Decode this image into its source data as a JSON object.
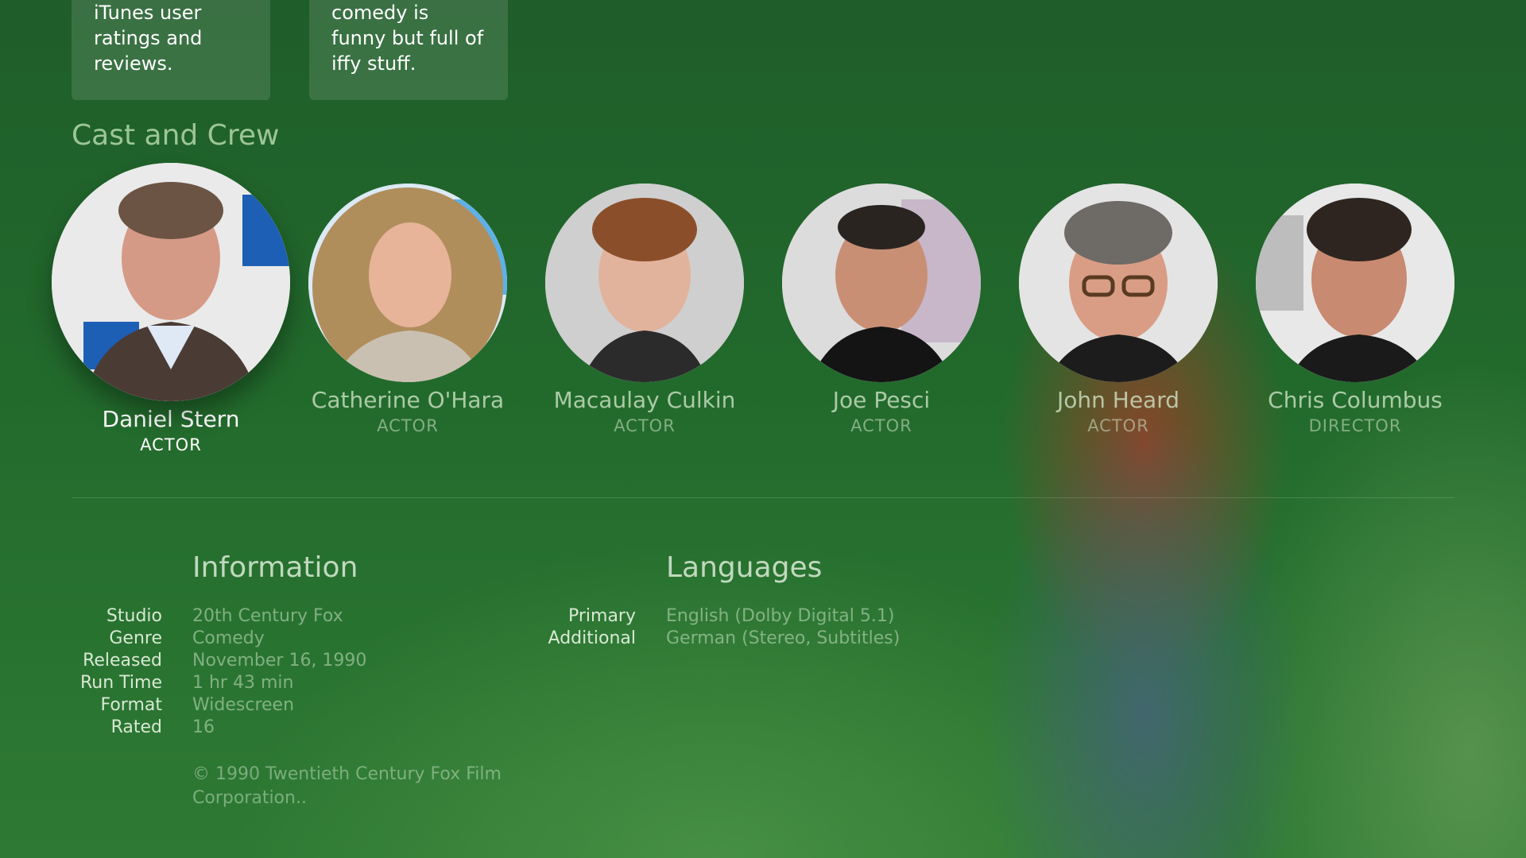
{
  "reviews": [
    {
      "text": "iTunes user ratings and reviews."
    },
    {
      "text": "comedy is funny but full of iffy stuff."
    }
  ],
  "cast_section": {
    "title": "Cast and Crew",
    "people": [
      {
        "name": "Daniel Stern",
        "role": "ACTOR"
      },
      {
        "name": "Catherine O'Hara",
        "role": "ACTOR"
      },
      {
        "name": "Macaulay Culkin",
        "role": "ACTOR"
      },
      {
        "name": "Joe Pesci",
        "role": "ACTOR"
      },
      {
        "name": "John Heard",
        "role": "ACTOR"
      },
      {
        "name": "Chris Columbus",
        "role": "DIRECTOR"
      }
    ]
  },
  "information": {
    "title": "Information",
    "rows": [
      {
        "label": "Studio",
        "value": "20th Century Fox"
      },
      {
        "label": "Genre",
        "value": "Comedy"
      },
      {
        "label": "Released",
        "value": "November 16, 1990"
      },
      {
        "label": "Run Time",
        "value": "1 hr 43 min"
      },
      {
        "label": "Format",
        "value": "Widescreen"
      },
      {
        "label": "Rated",
        "value": "16"
      }
    ],
    "copyright": "© 1990 Twentieth Century Fox Film Corporation.."
  },
  "languages": {
    "title": "Languages",
    "rows": [
      {
        "label": "Primary",
        "value": "English (Dolby Digital 5.1)"
      },
      {
        "label": "Additional",
        "value": "German (Stereo, Subtitles)"
      }
    ]
  },
  "colors": {
    "background_top": "#1f5d2a",
    "background_bottom": "#2e7a34",
    "section_title": "#b4d7aa"
  }
}
